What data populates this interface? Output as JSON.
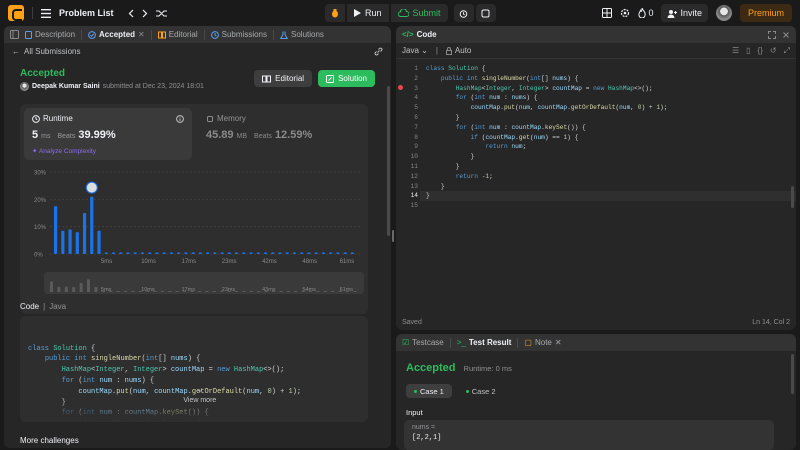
{
  "topbar": {
    "problem_list": "Problem List",
    "run": "Run",
    "submit": "Submit",
    "streak": "0",
    "invite": "Invite",
    "premium": "Premium"
  },
  "left_tabs": [
    {
      "label": "Description"
    },
    {
      "label": "Accepted"
    },
    {
      "label": "Editorial"
    },
    {
      "label": "Submissions"
    },
    {
      "label": "Solutions"
    }
  ],
  "all_submissions": "All Submissions",
  "result": {
    "status": "Accepted",
    "user": "Deepak Kumar Saini",
    "submitted": "submitted at Dec 23, 2024 18:01",
    "editorial_btn": "Editorial",
    "solution_btn": "Solution"
  },
  "runtime": {
    "label": "Runtime",
    "value": "5",
    "unit": "ms",
    "beats_label": "Beats",
    "beats": "39.99%",
    "analyze": "Analyze Complexity"
  },
  "memory": {
    "label": "Memory",
    "value": "45.89",
    "unit": "MB",
    "beats_label": "Beats",
    "beats": "12.59%"
  },
  "chart_data": {
    "type": "bar",
    "ylabel": "",
    "xlabel": "",
    "yticks": [
      "30%",
      "20%",
      "10%",
      "0%"
    ],
    "ylim": [
      0,
      30
    ],
    "xtick_labels": [
      "5ms",
      "10ms",
      "17ms",
      "23ms",
      "42ms",
      "48ms",
      "61ms"
    ],
    "values": [
      17.5,
      8.5,
      9,
      8,
      15,
      21,
      8.5,
      0.6,
      0.6,
      0.6,
      0.6,
      0.6,
      0.6,
      0.6,
      0.6,
      0.6,
      0.6,
      0.6,
      0.6,
      0.6,
      0.6,
      0.6,
      0.6,
      0.6,
      0.6,
      0.6,
      0.6,
      0.6,
      0.6,
      0.6,
      0.6,
      0.6,
      0.6,
      0.6,
      0.6,
      0.6,
      0.6,
      0.6,
      0.6,
      0.6,
      0.6,
      0.6
    ],
    "highlight_index": 5,
    "bar_color": "#1a73e8"
  },
  "minimap_labels": [
    "5ms",
    "10ms",
    "17ms",
    "23ms",
    "43ms",
    "54ms",
    "61ms"
  ],
  "code_section": {
    "label": "Code",
    "lang": "Java",
    "lines": [
      "class Solution {",
      "    public int singleNumber(int[] nums) {",
      "        HashMap<Integer, Integer> countMap = new HashMap<>();",
      "        for (int num : nums) {",
      "            countMap.put(num, countMap.getOrDefault(num, 0) + 1);",
      "        }",
      "        for (int num : countMap.keySet()) {",
      "            if (countMap.get(num) == 1) {"
    ],
    "view_more": "View more"
  },
  "more_challenges": "More challenges",
  "editor": {
    "title": "Code",
    "lang": "Java",
    "auto": "Auto",
    "lines": [
      "class Solution {",
      "    public int singleNumber(int[] nums) {",
      "        HashMap<Integer, Integer> countMap = new HashMap<>();",
      "        for (int num : nums) {",
      "            countMap.put(num, countMap.getOrDefault(num, 0) + 1);",
      "        }",
      "        for (int num : countMap.keySet()) {",
      "            if (countMap.get(num) == 1) {",
      "                return num;",
      "            }",
      "        }",
      "        return -1;",
      "    }",
      "}",
      ""
    ],
    "saved": "Saved",
    "cursor": "Ln 14, Col 2"
  },
  "testpanel": {
    "tabs": [
      "Testcase",
      "Test Result",
      "Note"
    ],
    "status": "Accepted",
    "runtime": "Runtime: 0 ms",
    "cases": [
      "Case 1",
      "Case 2"
    ],
    "input_label": "Input",
    "param": "nums =",
    "value": "[2,2,1]"
  }
}
